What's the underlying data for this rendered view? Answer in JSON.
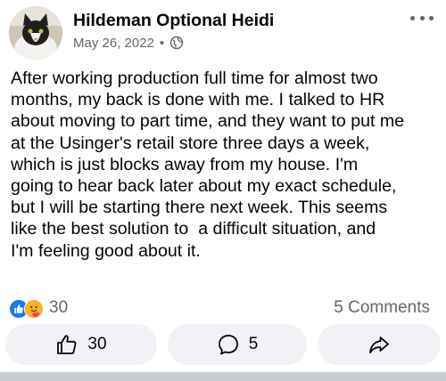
{
  "post": {
    "author": "Hildeman Optional Heidi",
    "date": "May 26, 2022",
    "separator": "•",
    "privacy_icon": "globe-icon",
    "more_icon": "more-horizontal-icon",
    "avatar_alt": "cat-avatar",
    "text_lines": [
      "After working production full time for almost two",
      "months, my back is done with me. I talked to HR",
      "about moving to part time, and they want to put me",
      "at the Usinger's retail store three days a week,",
      "which is just blocks away from my house. I'm",
      "going to hear back later about my exact schedule,",
      "but I will be starting there next week. This seems",
      "like the best solution to  a difficult situation, and",
      "I'm feeling good about it."
    ]
  },
  "stats": {
    "reaction_icons": [
      "like-icon",
      "care-icon"
    ],
    "reaction_count": "30",
    "comments_label": "5 Comments"
  },
  "actions": {
    "like": {
      "icon": "thumbs-up-icon",
      "count": "30"
    },
    "comment": {
      "icon": "comment-bubble-icon",
      "count": "5"
    },
    "share": {
      "icon": "share-arrow-icon"
    }
  },
  "colors": {
    "primary_text": "#050505",
    "secondary_text": "#65676b",
    "button_bg": "#f0f2f5",
    "like_blue": "#1877f2",
    "care_yellow": "#f7b125"
  }
}
